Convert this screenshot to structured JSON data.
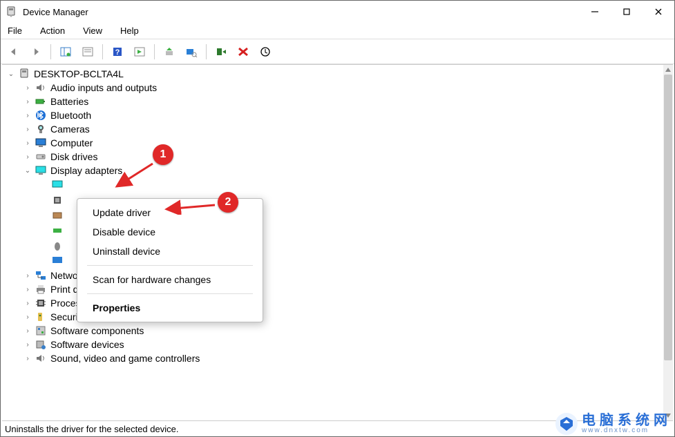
{
  "window": {
    "title": "Device Manager"
  },
  "menubar": {
    "file": "File",
    "action": "Action",
    "view": "View",
    "help": "Help"
  },
  "root_node": "DESKTOP-BCLTA4L",
  "categories": {
    "audio": "Audio inputs and outputs",
    "batteries": "Batteries",
    "bluetooth": "Bluetooth",
    "cameras": "Cameras",
    "computer": "Computer",
    "disk": "Disk drives",
    "display": "Display adapters",
    "network": "Network adapters",
    "print": "Print queues",
    "processors": "Processors",
    "security": "Security devices",
    "swcomp": "Software components",
    "swdev": "Software devices",
    "sound": "Sound, video and game controllers"
  },
  "context_menu": {
    "update": "Update driver",
    "disable": "Disable device",
    "uninstall": "Uninstall device",
    "scan": "Scan for hardware changes",
    "properties": "Properties"
  },
  "statusbar": "Uninstalls the driver for the selected device.",
  "annotations": {
    "callout1": "1",
    "callout2": "2"
  },
  "watermark": {
    "big": "电脑系统网",
    "small": "www.dnxtw.com"
  }
}
